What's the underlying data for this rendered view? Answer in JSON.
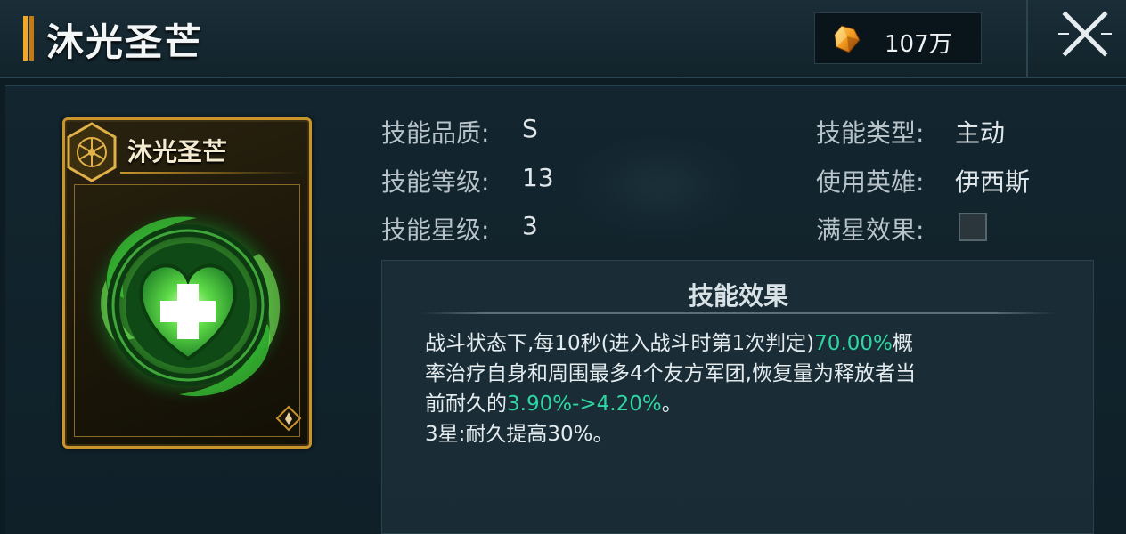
{
  "header": {
    "title": "沐光圣芒",
    "currency_value": "107万"
  },
  "card": {
    "title": "沐光圣芒"
  },
  "stats": {
    "quality_label": "技能品质:",
    "quality_value": "S",
    "level_label": "技能等级:",
    "level_value": "13",
    "star_label": "技能星级:",
    "star_value": "3",
    "type_label": "技能类型:",
    "type_value": "主动",
    "hero_label": "使用英雄:",
    "hero_value": "伊西斯",
    "fullstar_label": "满星效果:"
  },
  "effect": {
    "title": "技能效果",
    "line1_pre": "战斗状态下,每10秒(进入战斗时第1次判定)",
    "line1_highlight": "70.00%",
    "line1_post": "概",
    "line2": "率治疗自身和周围最多4个友方军团,恢复量为释放者当",
    "line3_pre": "前耐久的",
    "line3_highlight": "3.90%->4.20%",
    "line3_post": "。",
    "line4": "3星:耐久提高30%。"
  },
  "colors": {
    "accent_gold": "#c9952a",
    "highlight_green": "#2ed6a2"
  },
  "icons": {
    "currency": "gem-icon",
    "close": "close-icon",
    "card_emblem": "hex-emblem-icon",
    "card_badge": "rank-badge-icon",
    "skill_art": "heart-heal-icon"
  }
}
